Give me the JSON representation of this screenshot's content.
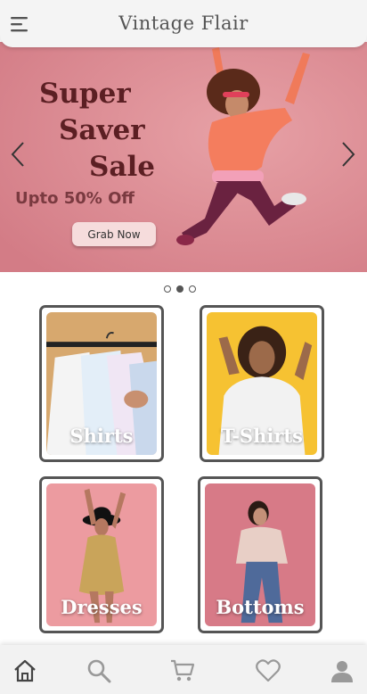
{
  "header": {
    "title": "Vintage Flair",
    "menu_icon": "menu-icon"
  },
  "banner": {
    "title_lines": [
      "Super",
      "Saver",
      "Sale"
    ],
    "subtitle": "Upto 50% Off",
    "button_label": "Grab Now",
    "background_color": "#dc8a93",
    "title_color": "#5b1f23"
  },
  "carousel": {
    "total_slides": 3,
    "active_index": 1
  },
  "categories": [
    {
      "label": "Shirts",
      "image": "shirts-on-hangers-image"
    },
    {
      "label": "T-Shirts",
      "image": "tshirt-model-image"
    },
    {
      "label": "Dresses",
      "image": "dress-model-image"
    },
    {
      "label": "Bottoms",
      "image": "bottoms-model-image"
    }
  ],
  "bottom_nav": {
    "items": [
      "home-icon",
      "search-icon",
      "cart-icon",
      "heart-icon",
      "profile-icon"
    ],
    "active": "home-icon"
  }
}
